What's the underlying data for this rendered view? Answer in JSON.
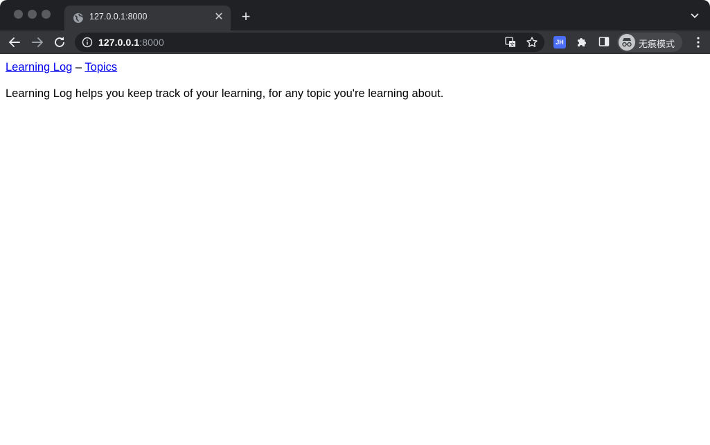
{
  "browser": {
    "tab": {
      "title": "127.0.0.1:8000",
      "icon": "globe-icon"
    },
    "new_tab_label": "+",
    "address": {
      "host": "127.0.0.1",
      "port": ":8000"
    },
    "extension_badge": "JH",
    "incognito_label": "无痕模式",
    "colors": {
      "tabstrip": "#202124",
      "toolbar": "#35363a",
      "omnibox": "#202124",
      "link": "#0000ee"
    }
  },
  "page": {
    "nav": {
      "home_link": "Learning Log",
      "separator": " – ",
      "topics_link": "Topics"
    },
    "description": "Learning Log helps you keep track of your learning, for any topic you're learning about."
  }
}
